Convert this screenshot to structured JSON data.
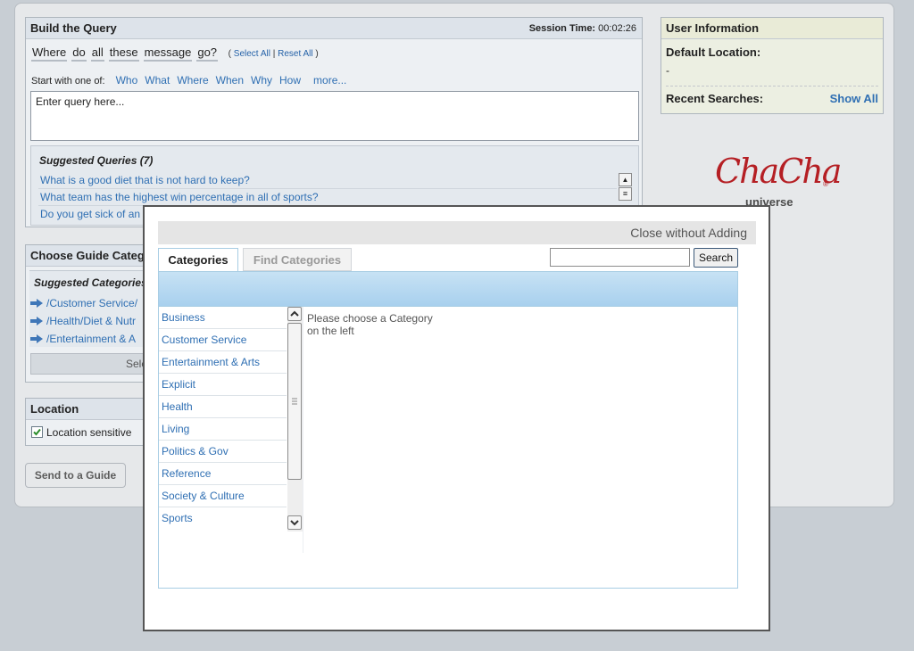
{
  "build_panel": {
    "title": "Build the Query",
    "session_label": "Session Time:",
    "session_value": "00:02:26",
    "words": [
      "Where",
      "do",
      "all",
      "these",
      "message",
      "go?"
    ],
    "open_paren": "(",
    "select_all": "Select All",
    "divider": "|",
    "reset_all": "Reset All",
    "close_paren": ")",
    "start_label": "Start with one of:",
    "start_words": [
      "Who",
      "What",
      "Where",
      "When",
      "Why",
      "How",
      "more..."
    ],
    "query_placeholder": "Enter query here...",
    "suggested_title": "Suggested Queries (7)",
    "suggested_queries": [
      "What is a good diet that is not hard to keep?",
      "What team has the highest win percentage in all of sports?",
      "Do you get sick of an"
    ]
  },
  "guide_panel": {
    "title": "Choose Guide Categ",
    "suggested_title": "Suggested Categories",
    "items": [
      "/Customer Service/",
      "/Health/Diet & Nutr",
      "/Entertainment & A"
    ],
    "select_button": "Sele"
  },
  "location_panel": {
    "title": "Location",
    "checkbox_label": "Location sensitive",
    "checked": true
  },
  "send_button": "Send to a Guide",
  "user_info": {
    "title": "User Information",
    "default_location_label": "Default Location:",
    "default_location_value": "-",
    "recent_searches_label": "Recent Searches:",
    "show_all": "Show All"
  },
  "logo": {
    "text": "ChaCha",
    "registered": "®",
    "sub": "universe",
    "brand_color": "#b51f24"
  },
  "modal": {
    "close_label": "Close without Adding",
    "tab_categories": "Categories",
    "tab_find": "Find Categories",
    "search_value": "",
    "search_button": "Search",
    "categories": [
      "Business",
      "Customer Service",
      "Entertainment & Arts",
      "Explicit",
      "Health",
      "Living",
      "Politics & Gov",
      "Reference",
      "Society & Culture",
      "Sports"
    ],
    "hint_line1": "Please choose a Category",
    "hint_line2": "on the left"
  },
  "colors": {
    "link": "#2f6fb3",
    "band": "#a8d0ee",
    "panel_bg": "#edf0f3"
  }
}
